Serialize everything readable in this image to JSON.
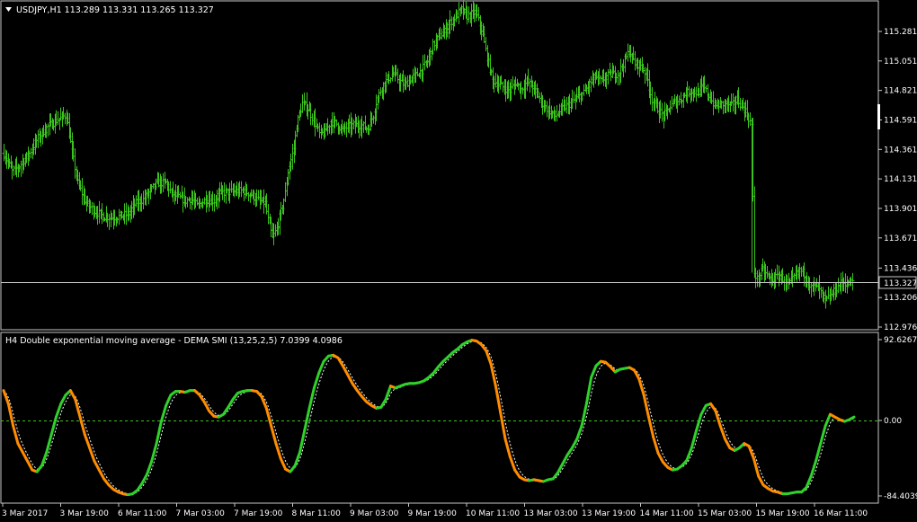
{
  "main_panel": {
    "title": "USDJPY,H1  113.289 113.331 113.265 113.327",
    "menu_icon": "triangle-down-icon",
    "price_labels": [
      "115.281",
      "115.051",
      "114.821",
      "114.591",
      "114.361",
      "114.131",
      "113.901",
      "113.671",
      "113.436",
      "113.206",
      "112.976"
    ],
    "current_price": "113.327",
    "bar_color": "#3cc31e"
  },
  "indicator_panel": {
    "title": "H4 Double exponential moving average - DEMA SMI (13,25,2,5) 7.0399 4.0986",
    "scale_labels": [
      "92.6267",
      "0.00",
      "-84.4039"
    ],
    "up_color": "#2fd12a",
    "down_color": "#ff8c00",
    "signal_color": "#ffffff"
  },
  "time_axis": {
    "labels": [
      "3 Mar 2017",
      "3 Mar 19:00",
      "6 Mar 11:00",
      "7 Mar 03:00",
      "7 Mar 19:00",
      "8 Mar 11:00",
      "9 Mar 03:00",
      "9 Mar 19:00",
      "10 Mar 11:00",
      "13 Mar 03:00",
      "13 Mar 19:00",
      "14 Mar 11:00",
      "15 Mar 03:00",
      "15 Mar 19:00",
      "16 Mar 11:00"
    ]
  },
  "chart_data": {
    "type": "line",
    "symbol": "USDJPY",
    "timeframe": "H1",
    "price_range": [
      112.93,
      115.48
    ],
    "price_close_key": [
      [
        0,
        114.33
      ],
      [
        6,
        114.19
      ],
      [
        10,
        114.22
      ],
      [
        18,
        114.33
      ],
      [
        24,
        114.45
      ],
      [
        30,
        114.53
      ],
      [
        36,
        114.58
      ],
      [
        44,
        114.63
      ],
      [
        48,
        114.34
      ],
      [
        52,
        114.1
      ],
      [
        58,
        113.94
      ],
      [
        64,
        113.88
      ],
      [
        70,
        113.84
      ],
      [
        76,
        113.83
      ],
      [
        82,
        113.84
      ],
      [
        88,
        113.86
      ],
      [
        92,
        113.93
      ],
      [
        94,
        113.95
      ],
      [
        98,
        113.97
      ],
      [
        104,
        114.05
      ],
      [
        108,
        114.1
      ],
      [
        114,
        114.1
      ],
      [
        118,
        114.02
      ],
      [
        122,
        113.99
      ],
      [
        128,
        113.96
      ],
      [
        132,
        113.98
      ],
      [
        136,
        113.92
      ],
      [
        142,
        113.97
      ],
      [
        148,
        113.96
      ],
      [
        152,
        114.02
      ],
      [
        160,
        114.03
      ],
      [
        168,
        114.04
      ],
      [
        174,
        114.01
      ],
      [
        178,
        113.97
      ],
      [
        184,
        113.94
      ],
      [
        186,
        113.81
      ],
      [
        189,
        113.67
      ],
      [
        192,
        113.74
      ],
      [
        196,
        113.92
      ],
      [
        198,
        114.02
      ],
      [
        200,
        114.19
      ],
      [
        204,
        114.37
      ],
      [
        206,
        114.55
      ],
      [
        210,
        114.72
      ],
      [
        214,
        114.68
      ],
      [
        218,
        114.59
      ],
      [
        222,
        114.48
      ],
      [
        226,
        114.49
      ],
      [
        230,
        114.58
      ],
      [
        234,
        114.56
      ],
      [
        238,
        114.51
      ],
      [
        242,
        114.54
      ],
      [
        246,
        114.55
      ],
      [
        252,
        114.55
      ],
      [
        256,
        114.52
      ],
      [
        260,
        114.63
      ],
      [
        262,
        114.73
      ],
      [
        266,
        114.85
      ],
      [
        270,
        114.91
      ],
      [
        274,
        114.95
      ],
      [
        278,
        114.9
      ],
      [
        282,
        114.86
      ],
      [
        286,
        114.91
      ],
      [
        290,
        114.94
      ],
      [
        294,
        114.98
      ],
      [
        298,
        115.05
      ],
      [
        302,
        115.17
      ],
      [
        306,
        115.24
      ],
      [
        310,
        115.28
      ],
      [
        314,
        115.35
      ],
      [
        318,
        115.4
      ],
      [
        322,
        115.45
      ],
      [
        326,
        115.4
      ],
      [
        330,
        115.42
      ],
      [
        332,
        115.43
      ],
      [
        336,
        115.3
      ],
      [
        340,
        115.08
      ],
      [
        344,
        114.9
      ],
      [
        348,
        114.87
      ],
      [
        352,
        114.84
      ],
      [
        356,
        114.82
      ],
      [
        360,
        114.88
      ],
      [
        364,
        114.83
      ],
      [
        368,
        114.89
      ],
      [
        372,
        114.85
      ],
      [
        376,
        114.78
      ],
      [
        380,
        114.7
      ],
      [
        384,
        114.66
      ],
      [
        388,
        114.62
      ],
      [
        392,
        114.67
      ],
      [
        396,
        114.7
      ],
      [
        400,
        114.73
      ],
      [
        404,
        114.77
      ],
      [
        408,
        114.8
      ],
      [
        412,
        114.87
      ],
      [
        416,
        114.93
      ],
      [
        420,
        114.89
      ],
      [
        424,
        114.93
      ],
      [
        428,
        114.95
      ],
      [
        432,
        114.95
      ],
      [
        436,
        115.03
      ],
      [
        440,
        115.13
      ],
      [
        442,
        115.08
      ],
      [
        444,
        115.03
      ],
      [
        448,
        115.02
      ],
      [
        452,
        114.95
      ],
      [
        456,
        114.75
      ],
      [
        460,
        114.68
      ],
      [
        464,
        114.62
      ],
      [
        468,
        114.68
      ],
      [
        472,
        114.73
      ],
      [
        476,
        114.75
      ],
      [
        480,
        114.8
      ],
      [
        484,
        114.82
      ],
      [
        488,
        114.8
      ],
      [
        492,
        114.85
      ],
      [
        496,
        114.78
      ],
      [
        500,
        114.7
      ],
      [
        504,
        114.71
      ],
      [
        508,
        114.72
      ],
      [
        512,
        114.7
      ],
      [
        516,
        114.75
      ],
      [
        518,
        114.72
      ],
      [
        522,
        114.66
      ],
      [
        526,
        114.55
      ],
      [
        528,
        113.4
      ],
      [
        530,
        113.35
      ],
      [
        534,
        113.42
      ],
      [
        540,
        113.34
      ],
      [
        546,
        113.38
      ],
      [
        552,
        113.3
      ],
      [
        556,
        113.36
      ],
      [
        560,
        113.42
      ],
      [
        564,
        113.38
      ],
      [
        568,
        113.28
      ],
      [
        572,
        113.3
      ],
      [
        578,
        113.18
      ],
      [
        582,
        113.22
      ],
      [
        586,
        113.28
      ],
      [
        590,
        113.33
      ],
      [
        594,
        113.31
      ],
      [
        597,
        113.33
      ]
    ],
    "smi_range": [
      -84.4039,
      92.6267
    ],
    "smi_key": [
      [
        0,
        35
      ],
      [
        3,
        20
      ],
      [
        6,
        -5
      ],
      [
        9,
        -25
      ],
      [
        12,
        -35
      ],
      [
        15,
        -45
      ],
      [
        18,
        -55
      ],
      [
        21,
        -57
      ],
      [
        24,
        -50
      ],
      [
        27,
        -35
      ],
      [
        30,
        -15
      ],
      [
        33,
        5
      ],
      [
        36,
        20
      ],
      [
        39,
        30
      ],
      [
        42,
        35
      ],
      [
        45,
        25
      ],
      [
        48,
        5
      ],
      [
        51,
        -15
      ],
      [
        54,
        -30
      ],
      [
        57,
        -45
      ],
      [
        60,
        -55
      ],
      [
        63,
        -65
      ],
      [
        66,
        -72
      ],
      [
        69,
        -77
      ],
      [
        72,
        -80
      ],
      [
        75,
        -82
      ],
      [
        78,
        -83
      ],
      [
        81,
        -82
      ],
      [
        84,
        -78
      ],
      [
        87,
        -70
      ],
      [
        90,
        -60
      ],
      [
        93,
        -45
      ],
      [
        96,
        -25
      ],
      [
        99,
        0
      ],
      [
        102,
        18
      ],
      [
        105,
        30
      ],
      [
        108,
        34
      ],
      [
        111,
        34
      ],
      [
        114,
        33
      ],
      [
        117,
        35
      ],
      [
        120,
        35
      ],
      [
        123,
        30
      ],
      [
        126,
        22
      ],
      [
        129,
        12
      ],
      [
        132,
        6
      ],
      [
        135,
        5
      ],
      [
        138,
        8
      ],
      [
        141,
        16
      ],
      [
        144,
        25
      ],
      [
        147,
        32
      ],
      [
        150,
        34
      ],
      [
        153,
        35
      ],
      [
        156,
        35
      ],
      [
        159,
        34
      ],
      [
        162,
        28
      ],
      [
        165,
        15
      ],
      [
        168,
        -5
      ],
      [
        171,
        -25
      ],
      [
        174,
        -42
      ],
      [
        177,
        -54
      ],
      [
        180,
        -57
      ],
      [
        183,
        -50
      ],
      [
        186,
        -35
      ],
      [
        189,
        -10
      ],
      [
        192,
        15
      ],
      [
        195,
        38
      ],
      [
        198,
        55
      ],
      [
        201,
        68
      ],
      [
        204,
        74
      ],
      [
        207,
        75
      ],
      [
        210,
        72
      ],
      [
        213,
        63
      ],
      [
        216,
        53
      ],
      [
        219,
        43
      ],
      [
        222,
        35
      ],
      [
        225,
        28
      ],
      [
        228,
        22
      ],
      [
        231,
        18
      ],
      [
        234,
        15
      ],
      [
        237,
        16
      ],
      [
        240,
        25
      ],
      [
        243,
        40
      ],
      [
        246,
        38
      ],
      [
        249,
        40
      ],
      [
        252,
        42
      ],
      [
        255,
        43
      ],
      [
        258,
        43
      ],
      [
        261,
        44
      ],
      [
        264,
        46
      ],
      [
        267,
        50
      ],
      [
        270,
        55
      ],
      [
        273,
        62
      ],
      [
        276,
        68
      ],
      [
        279,
        73
      ],
      [
        282,
        78
      ],
      [
        285,
        82
      ],
      [
        288,
        87
      ],
      [
        291,
        90
      ],
      [
        294,
        92
      ],
      [
        297,
        91
      ],
      [
        300,
        87
      ],
      [
        303,
        80
      ],
      [
        306,
        65
      ],
      [
        309,
        40
      ],
      [
        312,
        10
      ],
      [
        315,
        -20
      ],
      [
        318,
        -40
      ],
      [
        321,
        -55
      ],
      [
        324,
        -63
      ],
      [
        327,
        -66
      ],
      [
        330,
        -67
      ],
      [
        333,
        -66
      ],
      [
        336,
        -67
      ],
      [
        339,
        -68
      ],
      [
        342,
        -66
      ],
      [
        345,
        -65
      ],
      [
        348,
        -58
      ],
      [
        351,
        -48
      ],
      [
        354,
        -38
      ],
      [
        357,
        -30
      ],
      [
        360,
        -20
      ],
      [
        363,
        -5
      ],
      [
        366,
        20
      ],
      [
        369,
        50
      ],
      [
        372,
        63
      ],
      [
        375,
        68
      ],
      [
        378,
        67
      ],
      [
        381,
        62
      ],
      [
        384,
        56
      ],
      [
        387,
        59
      ],
      [
        390,
        60
      ],
      [
        393,
        61
      ],
      [
        396,
        58
      ],
      [
        399,
        48
      ],
      [
        402,
        30
      ],
      [
        405,
        5
      ],
      [
        408,
        -18
      ],
      [
        411,
        -36
      ],
      [
        414,
        -46
      ],
      [
        417,
        -52
      ],
      [
        420,
        -55
      ],
      [
        423,
        -54
      ],
      [
        426,
        -50
      ],
      [
        429,
        -44
      ],
      [
        432,
        -30
      ],
      [
        435,
        -10
      ],
      [
        438,
        8
      ],
      [
        441,
        18
      ],
      [
        444,
        20
      ],
      [
        447,
        12
      ],
      [
        450,
        -5
      ],
      [
        453,
        -20
      ],
      [
        456,
        -30
      ],
      [
        459,
        -33
      ],
      [
        462,
        -30
      ],
      [
        465,
        -25
      ],
      [
        468,
        -28
      ],
      [
        471,
        -42
      ],
      [
        474,
        -62
      ],
      [
        477,
        -72
      ],
      [
        480,
        -76
      ],
      [
        483,
        -79
      ],
      [
        486,
        -80
      ],
      [
        489,
        -82
      ],
      [
        492,
        -82
      ],
      [
        495,
        -81
      ],
      [
        498,
        -80
      ],
      [
        501,
        -80
      ],
      [
        504,
        -75
      ],
      [
        507,
        -62
      ],
      [
        510,
        -45
      ],
      [
        513,
        -25
      ],
      [
        516,
        -5
      ],
      [
        519,
        8
      ],
      [
        522,
        5
      ],
      [
        525,
        2
      ],
      [
        528,
        0
      ],
      [
        531,
        2
      ],
      [
        534,
        5
      ]
    ],
    "signal_smoothing": 5
  }
}
